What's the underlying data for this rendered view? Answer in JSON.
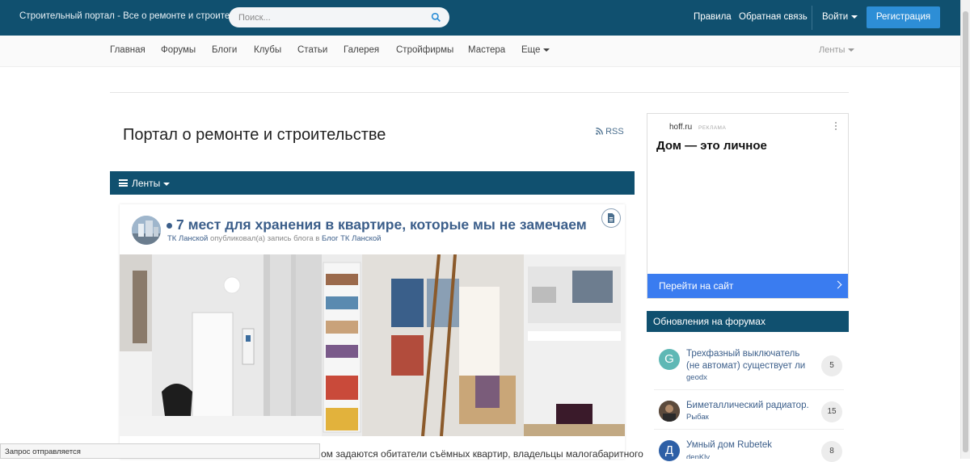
{
  "header": {
    "site_title": "Строительный портал - Все о ремонте и строительстве",
    "search_placeholder": "Поиск...",
    "links": {
      "rules": "Правила",
      "feedback": "Обратная связь"
    },
    "login": "Войти",
    "register": "Регистрация"
  },
  "nav": {
    "items": [
      "Главная",
      "Форумы",
      "Блоги",
      "Клубы",
      "Статьи",
      "Галерея",
      "Стройфирмы",
      "Мастера",
      "Еще"
    ],
    "right": "Ленты"
  },
  "main": {
    "title": "Портал о ремонте и строительстве",
    "rss": "RSS",
    "feed_label": "Ленты"
  },
  "post": {
    "title": "7 мест для хранения в квартире, которые мы не замечаем",
    "author": "ТК Ланской",
    "meta_text": "опубликовал(а) запись блога в",
    "blog": "Блог ТК Ланской",
    "excerpt": "ом задаются обитатели съёмных квартир, владельцы малогабаритного"
  },
  "status_bar": {
    "text": "Запрос отправляется"
  },
  "ad": {
    "site": "hoff.ru",
    "tag": "РЕКЛАМА",
    "headline": "Дом — это личное",
    "button": "Перейти на сайт"
  },
  "forum_updates": {
    "title": "Обновления на форумах",
    "items": [
      {
        "title": "Трехфазный выключатель (не автомат) существует ли",
        "author": "geodx",
        "count": "5",
        "letter": "G",
        "color": "#5fb8b5"
      },
      {
        "title": "Биметаллический радиатор.",
        "author": "Рыбак",
        "count": "15",
        "letter": "",
        "color": "#5b4a3c"
      },
      {
        "title": "Умный дом Rubetek",
        "author": "denKly",
        "count": "8",
        "letter": "Д",
        "color": "#2d5fa6"
      }
    ]
  },
  "colors": {
    "header_bg": "#10506f",
    "accent_button": "#2d8ed6",
    "link": "#3b5e8a",
    "ad_button": "#3a7cf0"
  },
  "icons": {
    "search": "search-icon",
    "menu": "hamburger-icon",
    "rss": "rss-icon",
    "document": "document-icon",
    "chevron": "chevron-right-icon"
  }
}
